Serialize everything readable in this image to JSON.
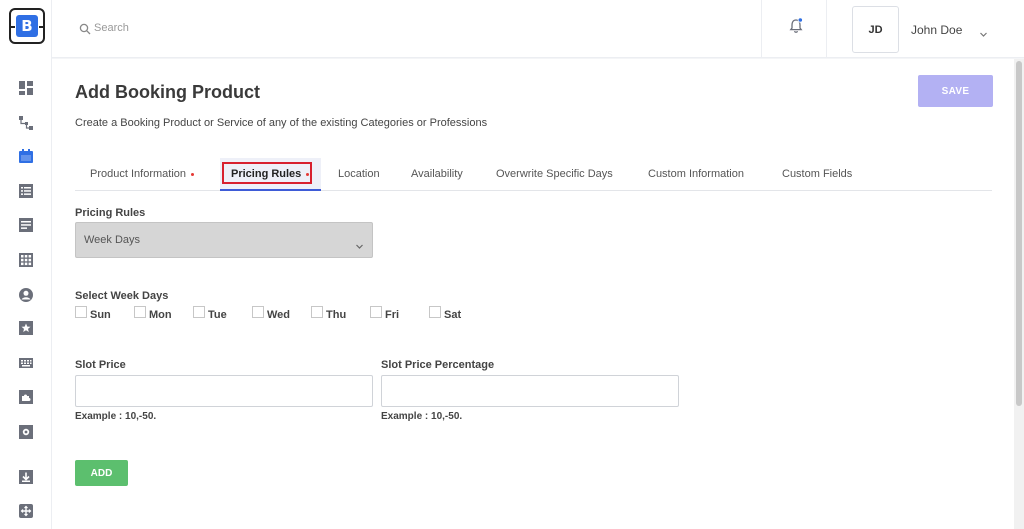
{
  "brand": {
    "logo_letter": "B",
    "accent": "#2f6fe4"
  },
  "sidebar": {
    "items": [
      {
        "icon": "dashboard-icon"
      },
      {
        "icon": "hierarchy-icon"
      },
      {
        "icon": "calendar-icon",
        "active": true
      },
      {
        "icon": "list-icon"
      },
      {
        "icon": "document-icon"
      },
      {
        "icon": "grid-icon"
      },
      {
        "icon": "user-icon"
      },
      {
        "icon": "star-icon"
      },
      {
        "icon": "keyboard-icon"
      },
      {
        "icon": "puzzle-icon"
      },
      {
        "icon": "settings-icon"
      },
      {
        "icon": "download-icon"
      },
      {
        "icon": "move-icon"
      }
    ]
  },
  "header": {
    "search": {
      "placeholder": "Search"
    },
    "notifications": {
      "icon": "bell-icon",
      "has_unread": true
    },
    "user": {
      "initials": "JD",
      "name": "John Doe"
    }
  },
  "main": {
    "title": "Add Booking Product",
    "description": "Create a Booking Product or Service of any of the existing Categories or Professions",
    "save_label": "SAVE",
    "tabs": [
      {
        "label": "Product Information",
        "required": true
      },
      {
        "label": "Pricing Rules",
        "required": true,
        "active": true
      },
      {
        "label": "Location"
      },
      {
        "label": "Availability"
      },
      {
        "label": "Overwrite Specific Days"
      },
      {
        "label": "Custom Information"
      },
      {
        "label": "Custom Fields"
      }
    ],
    "pricing_rules": {
      "label": "Pricing Rules",
      "selected": "Week Days"
    },
    "week_days": {
      "label": "Select Week Days",
      "days": [
        "Sun",
        "Mon",
        "Tue",
        "Wed",
        "Thu",
        "Fri",
        "Sat"
      ]
    },
    "slot_price": {
      "label": "Slot Price",
      "value": "",
      "hint": "Example : 10,-50."
    },
    "slot_price_percentage": {
      "label": "Slot Price Percentage",
      "value": "",
      "hint": "Example : 10,-50."
    },
    "add_label": "ADD"
  },
  "colors": {
    "save_button": "#b3b1f3",
    "add_button": "#5cbf6e",
    "tab_active_underline": "#3e5bd7",
    "required_dot": "#e53935"
  }
}
